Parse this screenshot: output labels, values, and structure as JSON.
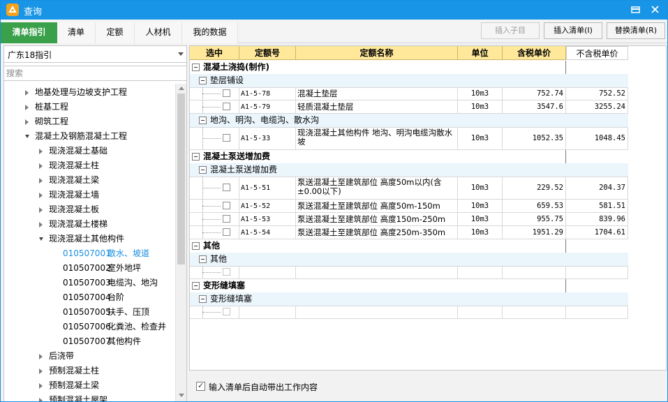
{
  "window": {
    "title": "查询",
    "minimize_icon": "minimize-icon",
    "close_icon": "close-icon"
  },
  "tabs": [
    {
      "label": "清单指引",
      "active": true
    },
    {
      "label": "清单",
      "active": false
    },
    {
      "label": "定额",
      "active": false
    },
    {
      "label": "人材机",
      "active": false
    },
    {
      "label": "我的数据",
      "active": false
    }
  ],
  "actions": {
    "insert_child": "插入子目",
    "insert_bill": "插入清单(I)",
    "replace_bill": "替换清单(R)"
  },
  "left": {
    "guide_select_value": "广东18指引",
    "search_placeholder": "搜索",
    "tree": [
      {
        "text": "地基处理与边坡支护工程",
        "level": 1,
        "state": "collapsed"
      },
      {
        "text": "桩基工程",
        "level": 1,
        "state": "collapsed"
      },
      {
        "text": "砌筑工程",
        "level": 1,
        "state": "collapsed"
      },
      {
        "text": "混凝土及钢筋混凝土工程",
        "level": 1,
        "state": "expanded"
      },
      {
        "text": "现浇混凝土基础",
        "level": 2,
        "state": "collapsed"
      },
      {
        "text": "现浇混凝土柱",
        "level": 2,
        "state": "collapsed"
      },
      {
        "text": "现浇混凝土梁",
        "level": 2,
        "state": "collapsed"
      },
      {
        "text": "现浇混凝土墙",
        "level": 2,
        "state": "collapsed"
      },
      {
        "text": "现浇混凝土板",
        "level": 2,
        "state": "collapsed"
      },
      {
        "text": "现浇混凝土楼梯",
        "level": 2,
        "state": "collapsed"
      },
      {
        "text": "现浇混凝土其他构件",
        "level": 2,
        "state": "expanded"
      },
      {
        "code": "010507001",
        "text": "散水、坡道",
        "level": 3,
        "state": "leaf",
        "selected": true
      },
      {
        "code": "010507002",
        "text": "室外地坪",
        "level": 3,
        "state": "leaf"
      },
      {
        "code": "010507003",
        "text": "电缆沟、地沟",
        "level": 3,
        "state": "leaf"
      },
      {
        "code": "010507004",
        "text": "台阶",
        "level": 3,
        "state": "leaf"
      },
      {
        "code": "010507005",
        "text": "扶手、压顶",
        "level": 3,
        "state": "leaf"
      },
      {
        "code": "010507006",
        "text": "化粪池、检查井",
        "level": 3,
        "state": "leaf"
      },
      {
        "code": "010507007",
        "text": "其他构件",
        "level": 3,
        "state": "leaf"
      },
      {
        "text": "后浇带",
        "level": 2,
        "state": "collapsed"
      },
      {
        "text": "预制混凝土柱",
        "level": 2,
        "state": "collapsed"
      },
      {
        "text": "预制混凝土梁",
        "level": 2,
        "state": "collapsed"
      },
      {
        "text": "预制混凝土屋架",
        "level": 2,
        "state": "collapsed"
      }
    ]
  },
  "grid": {
    "headers": [
      "选中",
      "定额号",
      "定额名称",
      "单位",
      "含税单价",
      "不含税单价"
    ],
    "rows": [
      {
        "type": "group1",
        "text": "混凝土浇捣(制作)"
      },
      {
        "type": "group2",
        "text": "垫层铺设"
      },
      {
        "type": "item",
        "code": "A1-5-78",
        "name": "混凝土垫层",
        "unit": "10m3",
        "tax": "752.74",
        "notax": "752.52"
      },
      {
        "type": "item",
        "code": "A1-5-79",
        "name": "轻质混凝土垫层",
        "unit": "10m3",
        "tax": "3547.6",
        "notax": "3255.24"
      },
      {
        "type": "group2",
        "text": "地沟、明沟、电缆沟、散水沟"
      },
      {
        "type": "item",
        "code": "A1-5-33",
        "name": "现浇混凝土其他构件 地沟、明沟电缆沟散水坡",
        "unit": "10m3",
        "tax": "1052.35",
        "notax": "1048.45",
        "tall": true
      },
      {
        "type": "group1",
        "text": "混凝土泵送增加费"
      },
      {
        "type": "group2",
        "text": "混凝土泵送增加费"
      },
      {
        "type": "item",
        "code": "A1-5-51",
        "name": "泵送混凝土至建筑部位 高度50m以内(含±0.00以下)",
        "unit": "10m3",
        "tax": "229.52",
        "notax": "204.37",
        "tall": true
      },
      {
        "type": "item",
        "code": "A1-5-52",
        "name": "泵送混凝土至建筑部位 高度50m-150m",
        "unit": "10m3",
        "tax": "659.53",
        "notax": "581.51"
      },
      {
        "type": "item",
        "code": "A1-5-53",
        "name": "泵送混凝土至建筑部位 高度150m-250m",
        "unit": "10m3",
        "tax": "955.75",
        "notax": "839.96"
      },
      {
        "type": "item",
        "code": "A1-5-54",
        "name": "泵送混凝土至建筑部位 高度250m-350m",
        "unit": "10m3",
        "tax": "1951.29",
        "notax": "1704.61"
      },
      {
        "type": "group1",
        "text": "其他"
      },
      {
        "type": "group2",
        "text": "其他"
      },
      {
        "type": "item",
        "empty": true
      },
      {
        "type": "group1",
        "text": "变形缝填塞"
      },
      {
        "type": "group2",
        "text": "变形缝填塞"
      },
      {
        "type": "item",
        "empty": true
      }
    ]
  },
  "footer": {
    "auto_content_label": "输入清单后自动带出工作内容",
    "auto_content_checked": true
  }
}
